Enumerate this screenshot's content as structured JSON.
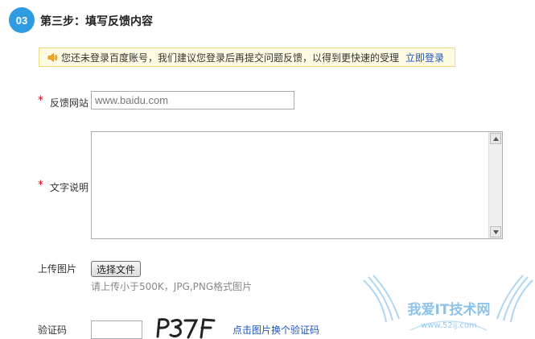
{
  "step": {
    "number": "03",
    "title": "第三步：填写反馈内容"
  },
  "notice": {
    "icon": "speaker-icon",
    "text": "您还未登录百度账号，我们建议您登录后再提交问题反馈，以得到更快速的受理",
    "login_link": "立即登录"
  },
  "form": {
    "required_mark": "*",
    "site": {
      "label": "反馈网站",
      "value": "www.baidu.com"
    },
    "description": {
      "label": "文字说明",
      "value": ""
    },
    "upload": {
      "label": "上传图片",
      "button": "选择文件",
      "hint": "请上传小于500K，JPG,PNG格式图片"
    },
    "captcha": {
      "label": "验证码",
      "value": "",
      "image_text": "P37F",
      "refresh_link": "点击图片换个验证码"
    }
  },
  "watermark": {
    "text": "我爱IT技术网",
    "url": "www.52ij.com"
  },
  "colors": {
    "badge": "#2f9be0",
    "link": "#1a55c4",
    "required": "#d0021b",
    "notice_bg": "#fffbe3",
    "notice_border": "#f0d986"
  }
}
